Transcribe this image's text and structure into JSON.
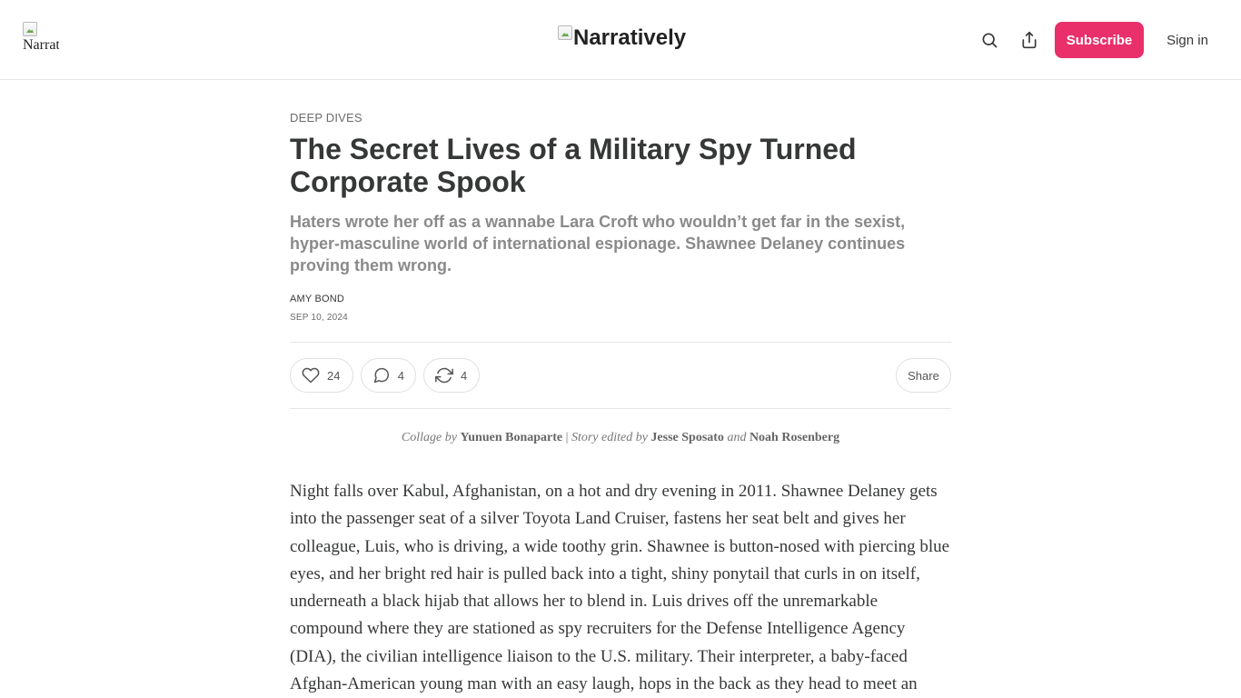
{
  "header": {
    "logo_left_alt": "Narratively",
    "logo_center_alt": "Narratively",
    "search_icon": "search-icon",
    "share_icon": "share-upload-icon",
    "subscribe_label": "Subscribe",
    "signin_label": "Sign in",
    "accent_color": "#e9306a"
  },
  "article": {
    "category": "DEEP DIVES",
    "title": "The Secret Lives of a Military Spy Turned Corporate Spook",
    "subtitle": "Haters wrote her off as a wannabe Lara Croft who wouldn’t get far in the sexist, hyper-masculine world of international espionage. Shawnee Delaney continues proving them wrong.",
    "author": "AMY BOND",
    "date": "SEP 10, 2024",
    "actions": {
      "like_icon": "heart-icon",
      "like_count": "24",
      "comment_icon": "comment-icon",
      "comment_count": "4",
      "restack_icon": "restack-icon",
      "restack_count": "4",
      "share_label": "Share"
    },
    "credits": {
      "collage_label": "Collage by",
      "collage_artist": "Yunuen Bonaparte",
      "separator": "|",
      "edited_label": "Story edited by",
      "editor_one": "Jesse Sposato",
      "and_word": "and",
      "editor_two": "Noah Rosenberg"
    },
    "body": "Night falls over Kabul, Afghanistan, on a hot and dry evening in 2011. Shawnee Delaney gets into the passenger seat of a silver Toyota Land Cruiser, fastens her seat belt and gives her colleague, Luis, who is driving, a wide toothy grin. Shawnee is button-nosed with piercing blue eyes, and her bright red hair is pulled back into a tight, shiny ponytail that curls in on itself, underneath a black hijab that allows her to blend in. Luis drives off the unremarkable compound where they are stationed as spy recruiters for the Defense Intelligence Agency (DIA), the civilian intelligence liaison to the U.S. military. Their interpreter, a baby-faced Afghan-American young man with an easy laugh, hops in the back as they head to meet an"
  }
}
